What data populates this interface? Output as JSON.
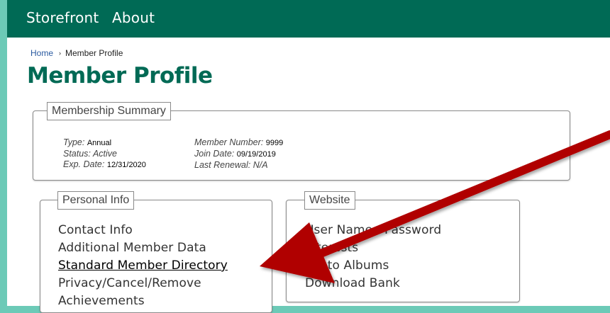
{
  "nav": {
    "items": [
      "Storefront",
      "About"
    ]
  },
  "breadcrumb": {
    "home": "Home",
    "separator": "›",
    "current": "Member Profile"
  },
  "page": {
    "title": "Member Profile"
  },
  "summary": {
    "legend": "Membership Summary",
    "type_label": "Type:",
    "type_value": "Annual",
    "status_label": "Status:",
    "status_value": "Active",
    "exp_label": "Exp. Date:",
    "exp_value": "12/31/2020",
    "member_number_label": "Member Number:",
    "member_number_value": "9999",
    "join_label": "Join Date:",
    "join_value": "09/19/2019",
    "renewal_label": "Last Renewal:",
    "renewal_value": "N/A"
  },
  "personal": {
    "legend": "Personal Info",
    "items": [
      "Contact Info",
      "Additional Member Data",
      "Standard Member Directory",
      "Privacy/Cancel/Remove",
      "Achievements"
    ]
  },
  "website": {
    "legend": "Website",
    "items": [
      "User Name / Password",
      "Interests",
      "Photo Albums",
      "Download Bank"
    ]
  },
  "colors": {
    "brand": "#006a55",
    "accent": "#6ccab7",
    "arrow": "#b00000"
  }
}
